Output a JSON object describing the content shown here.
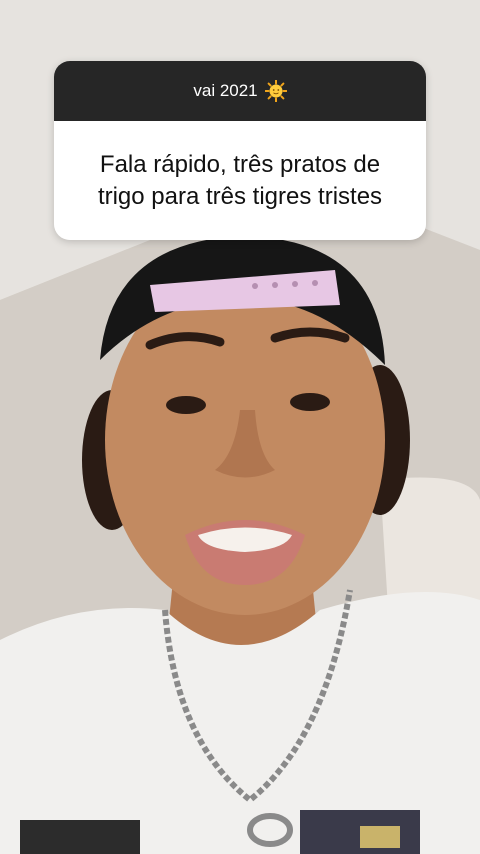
{
  "question_card": {
    "header": "vai 2021",
    "header_icon": "sun-face-emoji",
    "question": "Fala rápido, três pratos de trigo para três tigres tristes"
  },
  "colors": {
    "header_bg": "#262626",
    "body_bg": "#ffffff",
    "text_dark": "#111111"
  }
}
